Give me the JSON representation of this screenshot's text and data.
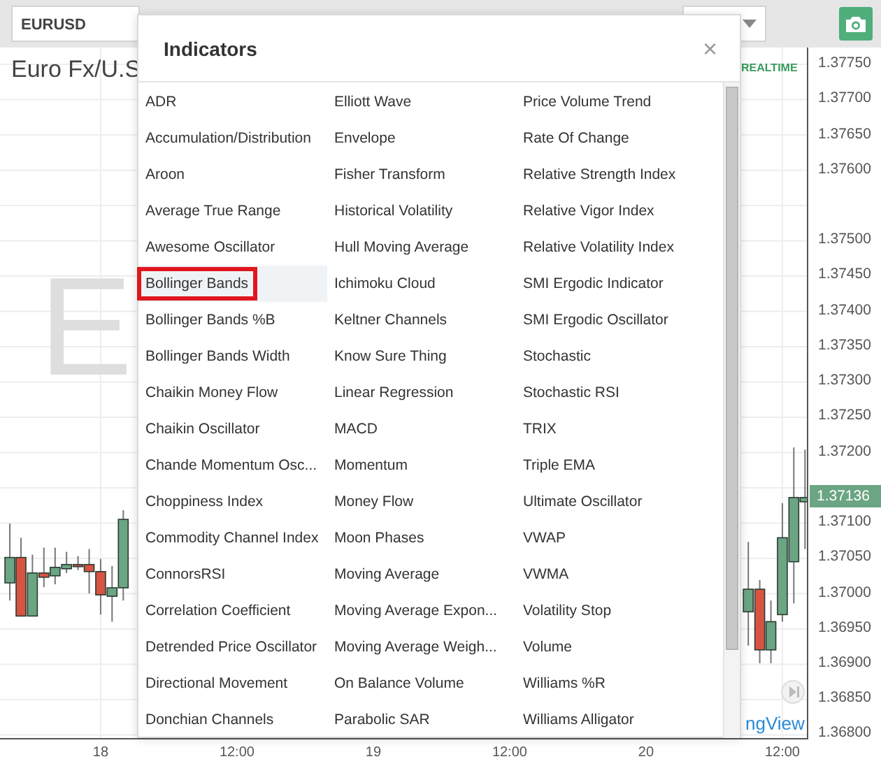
{
  "toolbar": {
    "symbol": "EURUSD"
  },
  "chart": {
    "title": "Euro Fx/U.S",
    "badge": "REALTIME",
    "watermark": "E",
    "logo": "ngView",
    "last_price": "1.37136",
    "midday_labels": [
      "12:00",
      "12:00",
      "12:00"
    ],
    "chart_data": {
      "type": "candlestick",
      "grid": true,
      "xlim": [
        17.631,
        20.595
      ],
      "ylim": [
        1.36795,
        1.37774
      ],
      "x": [
        17.667,
        17.708,
        17.75,
        17.792,
        17.833,
        17.875,
        17.917,
        17.958,
        18,
        18.042,
        18.083,
        20.375,
        20.417,
        20.458,
        20.5,
        20.542,
        20.583
      ],
      "ohlc": [
        [
          1.37015,
          1.37099,
          1.3699,
          1.37051
        ],
        [
          1.37051,
          1.37079,
          1.36968,
          1.36968
        ],
        [
          1.36968,
          1.37055,
          1.36968,
          1.37029
        ],
        [
          1.37029,
          1.37065,
          1.37009,
          1.37023
        ],
        [
          1.37025,
          1.37065,
          1.37013,
          1.37037
        ],
        [
          1.37035,
          1.37059,
          1.37029,
          1.37041
        ],
        [
          1.37041,
          1.37053,
          1.37033,
          1.37041
        ],
        [
          1.37041,
          1.37063,
          1.37,
          1.37031
        ],
        [
          1.37031,
          1.37049,
          1.3697,
          1.36998
        ],
        [
          1.36996,
          1.37039,
          1.3696,
          1.37008
        ],
        [
          1.37008,
          1.37118,
          1.3699,
          1.37105
        ],
        [
          1.36974,
          1.37073,
          1.36926,
          1.37006
        ],
        [
          1.37006,
          1.37019,
          1.36901,
          1.3692
        ],
        [
          1.3692,
          1.3699,
          1.36901,
          1.3696
        ],
        [
          1.3697,
          1.37128,
          1.3696,
          1.37079
        ],
        [
          1.37045,
          1.37207,
          1.36986,
          1.37136
        ],
        [
          1.3713,
          1.37204,
          1.37063,
          1.37136
        ]
      ],
      "xticks": [
        {
          "value": 18,
          "label": "18"
        },
        {
          "value": 19,
          "label": "19"
        },
        {
          "value": 20,
          "label": "20"
        }
      ],
      "yticks": [
        {
          "value": 1.3775,
          "label": "1.37750"
        },
        {
          "value": 1.377,
          "label": "1.37700"
        },
        {
          "value": 1.3765,
          "label": "1.37650"
        },
        {
          "value": 1.376,
          "label": "1.37600"
        },
        {
          "value": 1.375,
          "label": "1.37500"
        },
        {
          "value": 1.3745,
          "label": "1.37450"
        },
        {
          "value": 1.374,
          "label": "1.37400"
        },
        {
          "value": 1.3735,
          "label": "1.37350"
        },
        {
          "value": 1.373,
          "label": "1.37300"
        },
        {
          "value": 1.3725,
          "label": "1.37250"
        },
        {
          "value": 1.372,
          "label": "1.37200"
        },
        {
          "value": 1.371,
          "label": "1.37100"
        },
        {
          "value": 1.3705,
          "label": "1.37050"
        },
        {
          "value": 1.37,
          "label": "1.37000"
        },
        {
          "value": 1.3695,
          "label": "1.36950"
        },
        {
          "value": 1.369,
          "label": "1.36900"
        },
        {
          "value": 1.3685,
          "label": "1.36850"
        },
        {
          "value": 1.368,
          "label": "1.36800"
        }
      ]
    }
  },
  "dialog": {
    "title": "Indicators",
    "close": "×",
    "columns": [
      [
        {
          "label": "ADR",
          "selected": false
        },
        {
          "label": "Accumulation/Distribution",
          "selected": false
        },
        {
          "label": "Aroon",
          "selected": false
        },
        {
          "label": "Average True Range",
          "selected": false
        },
        {
          "label": "Awesome Oscillator",
          "selected": false
        },
        {
          "label": "Bollinger Bands",
          "selected": true
        },
        {
          "label": "Bollinger Bands %B",
          "selected": false
        },
        {
          "label": "Bollinger Bands Width",
          "selected": false
        },
        {
          "label": "Chaikin Money Flow",
          "selected": false
        },
        {
          "label": "Chaikin Oscillator",
          "selected": false
        },
        {
          "label": "Chande Momentum Osc...",
          "selected": false
        },
        {
          "label": "Choppiness Index",
          "selected": false
        },
        {
          "label": "Commodity Channel Index",
          "selected": false
        },
        {
          "label": "ConnorsRSI",
          "selected": false
        },
        {
          "label": "Correlation Coefficient",
          "selected": false
        },
        {
          "label": "Detrended Price Oscillator",
          "selected": false
        },
        {
          "label": "Directional Movement",
          "selected": false
        },
        {
          "label": "Donchian Channels",
          "selected": false
        }
      ],
      [
        {
          "label": "Elliott Wave",
          "selected": false
        },
        {
          "label": "Envelope",
          "selected": false
        },
        {
          "label": "Fisher Transform",
          "selected": false
        },
        {
          "label": "Historical Volatility",
          "selected": false
        },
        {
          "label": "Hull Moving Average",
          "selected": false
        },
        {
          "label": "Ichimoku Cloud",
          "selected": false
        },
        {
          "label": "Keltner Channels",
          "selected": false
        },
        {
          "label": "Know Sure Thing",
          "selected": false
        },
        {
          "label": "Linear Regression",
          "selected": false
        },
        {
          "label": "MACD",
          "selected": false
        },
        {
          "label": "Momentum",
          "selected": false
        },
        {
          "label": "Money Flow",
          "selected": false
        },
        {
          "label": "Moon Phases",
          "selected": false
        },
        {
          "label": "Moving Average",
          "selected": false
        },
        {
          "label": "Moving Average Expon...",
          "selected": false
        },
        {
          "label": "Moving Average Weigh...",
          "selected": false
        },
        {
          "label": "On Balance Volume",
          "selected": false
        },
        {
          "label": "Parabolic SAR",
          "selected": false
        }
      ],
      [
        {
          "label": "Price Volume Trend",
          "selected": false
        },
        {
          "label": "Rate Of Change",
          "selected": false
        },
        {
          "label": "Relative Strength Index",
          "selected": false
        },
        {
          "label": "Relative Vigor Index",
          "selected": false
        },
        {
          "label": "Relative Volatility Index",
          "selected": false
        },
        {
          "label": "SMI Ergodic Indicator",
          "selected": false
        },
        {
          "label": "SMI Ergodic Oscillator",
          "selected": false
        },
        {
          "label": "Stochastic",
          "selected": false
        },
        {
          "label": "Stochastic RSI",
          "selected": false
        },
        {
          "label": "TRIX",
          "selected": false
        },
        {
          "label": "Triple EMA",
          "selected": false
        },
        {
          "label": "Ultimate Oscillator",
          "selected": false
        },
        {
          "label": "VWAP",
          "selected": false
        },
        {
          "label": "VWMA",
          "selected": false
        },
        {
          "label": "Volatility Stop",
          "selected": false
        },
        {
          "label": "Volume",
          "selected": false
        },
        {
          "label": "Williams %R",
          "selected": false
        },
        {
          "label": "Williams Alligator",
          "selected": false
        }
      ]
    ]
  }
}
